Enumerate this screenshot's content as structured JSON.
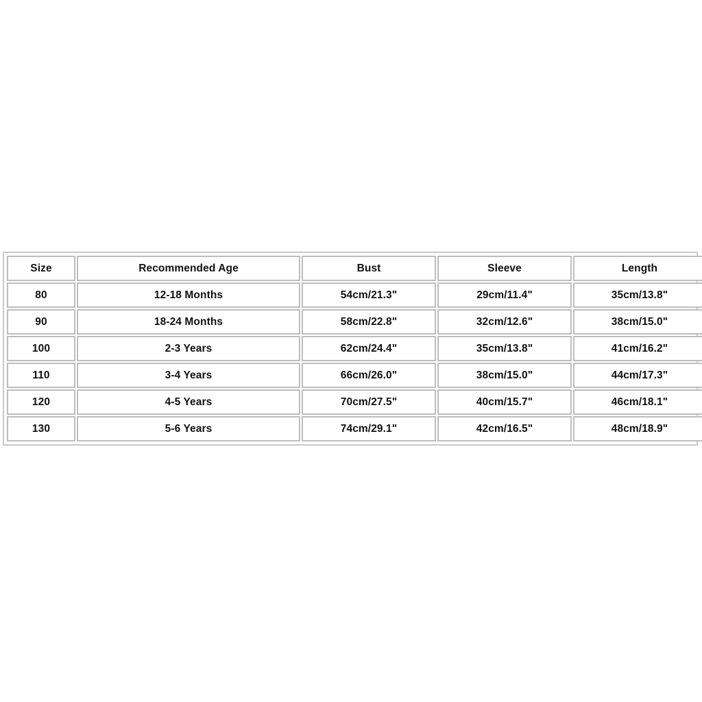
{
  "table": {
    "name": "size-chart",
    "headers": [
      "Size",
      "Recommended Age",
      "Bust",
      "Sleeve",
      "Length"
    ],
    "rows": [
      {
        "size": "80",
        "age": "12-18 Months",
        "bust": "54cm/21.3\"",
        "sleeve": "29cm/11.4\"",
        "length": "35cm/13.8\""
      },
      {
        "size": "90",
        "age": "18-24 Months",
        "bust": "58cm/22.8\"",
        "sleeve": "32cm/12.6\"",
        "length": "38cm/15.0\""
      },
      {
        "size": "100",
        "age": "2-3 Years",
        "bust": "62cm/24.4\"",
        "sleeve": "35cm/13.8\"",
        "length": "41cm/16.2\""
      },
      {
        "size": "110",
        "age": "3-4 Years",
        "bust": "66cm/26.0\"",
        "sleeve": "38cm/15.0\"",
        "length": "44cm/17.3\""
      },
      {
        "size": "120",
        "age": "4-5 Years",
        "bust": "70cm/27.5\"",
        "sleeve": "40cm/15.7\"",
        "length": "46cm/18.1\""
      },
      {
        "size": "130",
        "age": "5-6 Years",
        "bust": "74cm/29.1\"",
        "sleeve": "42cm/16.5\"",
        "length": "48cm/18.9\""
      }
    ]
  },
  "colors": {
    "page_background": "#ffffff",
    "cell_background": "#ffffff",
    "cell_border": "#bdbdbd",
    "outer_border": "#c9c9c9",
    "text": "#111111"
  }
}
